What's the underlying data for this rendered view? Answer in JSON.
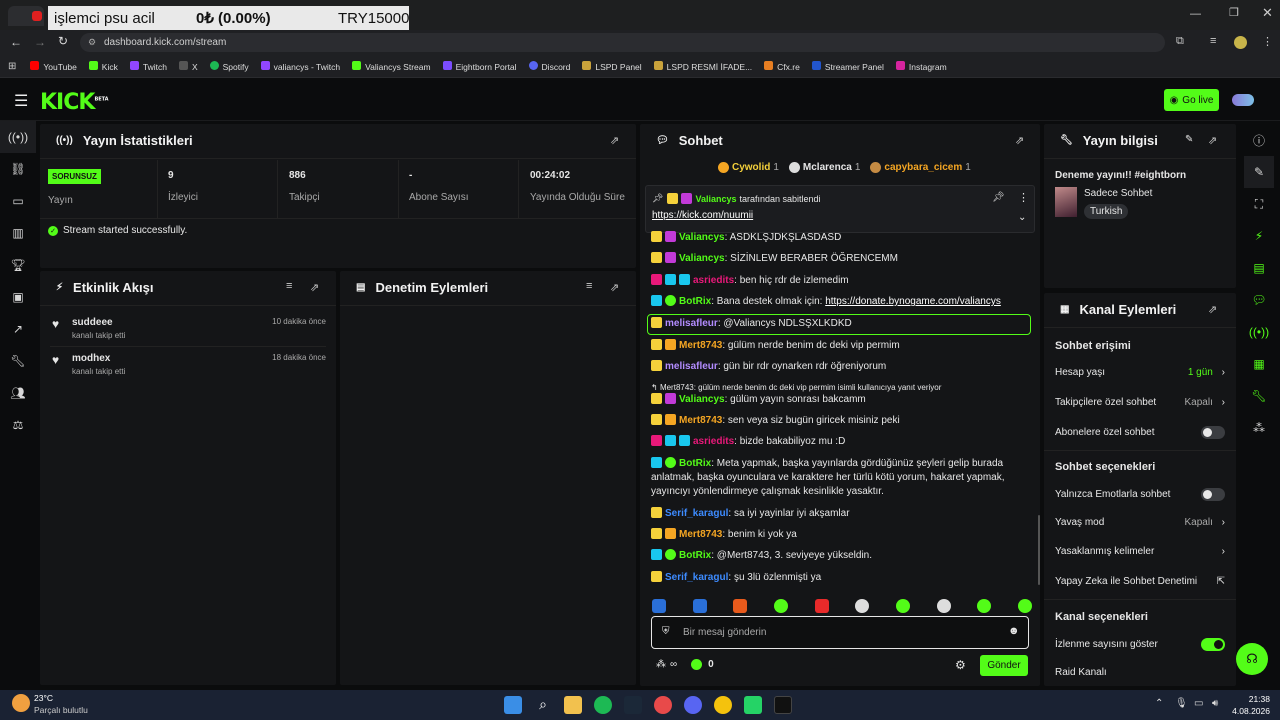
{
  "overlay": {
    "left": "işlemci psu acil",
    "mid": "0₺ (0.00%)",
    "right": "TRY15000"
  },
  "browser": {
    "url": "dashboard.kick.com/stream",
    "bookmarks": [
      "YouTube",
      "Kick",
      "Twitch",
      "X",
      "Spotify",
      "valiancys - Twitch",
      "Valiancys Stream",
      "Eightborn Portal",
      "Discord",
      "LSPD Panel",
      "LSPD  RESMİ İFADE...",
      "Cfx.re",
      "Streamer Panel",
      "Instagram"
    ]
  },
  "header": {
    "logo": "KICK",
    "beta": "BETA",
    "go_live": "Go live"
  },
  "stats": {
    "title": "Yayın İstatistikleri",
    "status_badge": "SORUNSUZ",
    "status_label": "Yayın",
    "viewers": "9",
    "viewers_label": "İzleyici",
    "followers": "886",
    "followers_label": "Takipçi",
    "subs": "-",
    "subs_label": "Abone Sayısı",
    "duration": "00:24:02",
    "duration_label": "Yayında Olduğu Süre",
    "message": "Stream started successfully."
  },
  "activity": {
    "title": "Etkinlik Akışı",
    "items": [
      {
        "name": "suddeee",
        "desc": "kanalı takip etti",
        "time": "10 dakika önce"
      },
      {
        "name": "modhex",
        "desc": "kanalı takip etti",
        "time": "18 dakika önce"
      }
    ]
  },
  "moderation": {
    "title": "Denetim Eylemleri"
  },
  "chat": {
    "title": "Sohbet",
    "top": [
      {
        "name": "Cywolid",
        "count": "1"
      },
      {
        "name": "Mclarenca",
        "count": "1"
      },
      {
        "name": "capybara_cicem",
        "count": "1"
      }
    ],
    "pinned_by": "Valiancys",
    "pinned_suffix": "tarafından sabitlendi",
    "pinned_link": "https://kick.com/nuumii",
    "messages": [
      {
        "user": "Valiancys",
        "text": "ASDKLŞJDKŞLASDASD"
      },
      {
        "user": "Valiancys",
        "text": "SİZİNLEW BERABER ÖĞRENCEMM"
      },
      {
        "user": "asriedits",
        "text": "ben hiç rdr de izlemedim"
      },
      {
        "user": "BotRix",
        "text": "Bana destek olmak için: ",
        "link": "https://donate.bynogame.com/valiancys"
      },
      {
        "user": "melisafleur",
        "text": "@Valiancys NDLSŞXLKDKD"
      },
      {
        "user": "Mert8743",
        "text": "gülüm nerde benim dc deki vip permim"
      },
      {
        "user": "melisafleur",
        "text": "gün bir rdr oynarken rdr öğreniyorum"
      },
      {
        "reply": "Mert8743: gülüm nerde benim dc deki vip permim isimli kullanıcıya yanıt veriyor"
      },
      {
        "user": "Valiancys",
        "text": "gülüm yayın sonrası bakcamm"
      },
      {
        "user": "Mert8743",
        "text": "sen veya siz bugün giricek misiniz peki"
      },
      {
        "user": "asriedits",
        "text": "bizde bakabiliyoz mu :D"
      },
      {
        "user": "BotRix",
        "text": "Meta yapmak, başka yayınlarda gördüğünüz şeyleri gelip burada anlatmak, başka oyunculara ve karaktere her türlü kötü yorum, hakaret yapmak, yayıncıyı yönlendirmeye çalışmak kesinlikle yasaktır."
      },
      {
        "user": "Serif_karagul",
        "text": "sa iyi yayinlar iyi akşamlar"
      },
      {
        "user": "Mert8743",
        "text": "benim ki yok ya"
      },
      {
        "user": "BotRix",
        "text": "@Mert8743, 3. seviyeye yükseldin."
      },
      {
        "user": "Serif_karagul",
        "text": "şu 3lü özlenmişti ya"
      }
    ],
    "input_placeholder": "Bir mesaj gönderin",
    "points": "0",
    "send": "Gönder"
  },
  "stream_info": {
    "title": "Yayın bilgisi",
    "stream_title": "Deneme yayını!! #eightborn",
    "category": "Sadece Sohbet",
    "language": "Turkish"
  },
  "channel_actions": {
    "title": "Kanal Eylemleri",
    "chat_access": "Sohbet erişimi",
    "account_age": "Hesap yaşı",
    "account_age_val": "1 gün",
    "followers_only": "Takipçilere özel sohbet",
    "followers_only_val": "Kapalı",
    "subs_only": "Abonelere özel sohbet",
    "chat_options": "Sohbet seçenekleri",
    "emote_only": "Yalnızca Emotlarla sohbet",
    "slow_mode": "Yavaş mod",
    "slow_mode_val": "Kapalı",
    "banned_words": "Yasaklanmış kelimeler",
    "ai_mod": "Yapay Zeka ile Sohbet Denetimi",
    "channel_options": "Kanal seçenekleri",
    "show_viewers": "İzlenme sayısını göster",
    "raid": "Raid Kanalı"
  },
  "taskbar": {
    "temp": "23°C",
    "weather": "Parçalı bulutlu",
    "time": "21:38",
    "date": "4.08.2026"
  },
  "colors": {
    "accent": "#53fc18",
    "panel": "#141517",
    "bg": "#0b0c0d"
  }
}
